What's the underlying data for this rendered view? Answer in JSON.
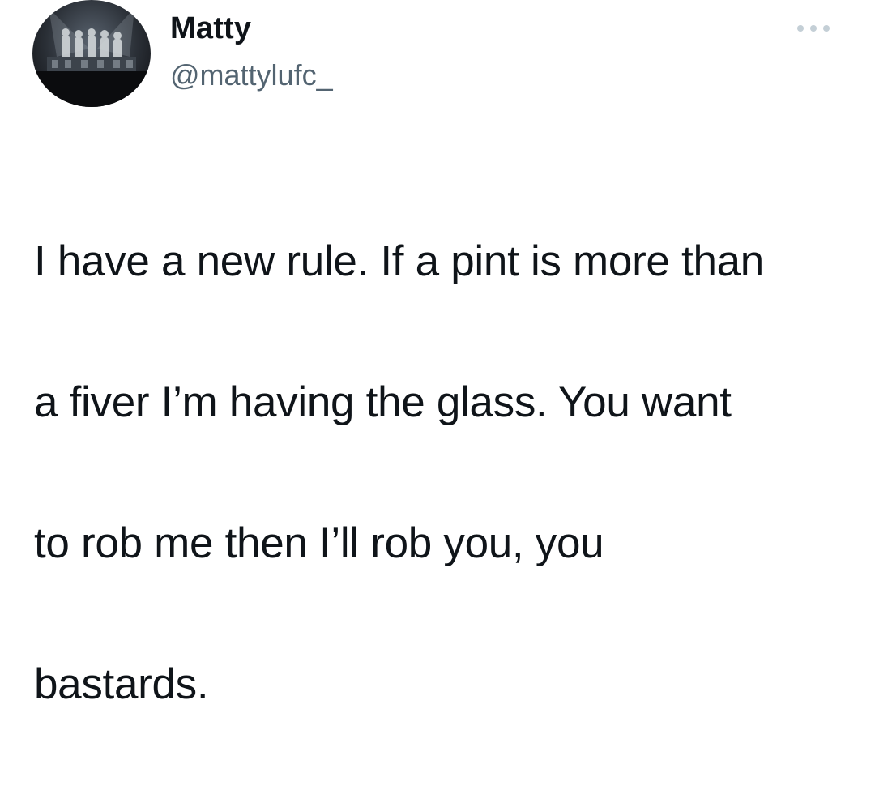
{
  "author": {
    "display_name": "Matty",
    "handle": "@mattylufc_"
  },
  "menu": {
    "icon": "more-horizontal-icon"
  },
  "tweet": {
    "text_lines": [
      "I have a new rule. If a pint is more than",
      "a fiver I’m having the glass. You want",
      "to rob me then I’ll rob you, you",
      "bastards."
    ]
  },
  "colors": {
    "background": "#ffffff",
    "text_primary": "#0f1419",
    "text_secondary": "#536471",
    "icon_muted": "#c4cfd6"
  }
}
